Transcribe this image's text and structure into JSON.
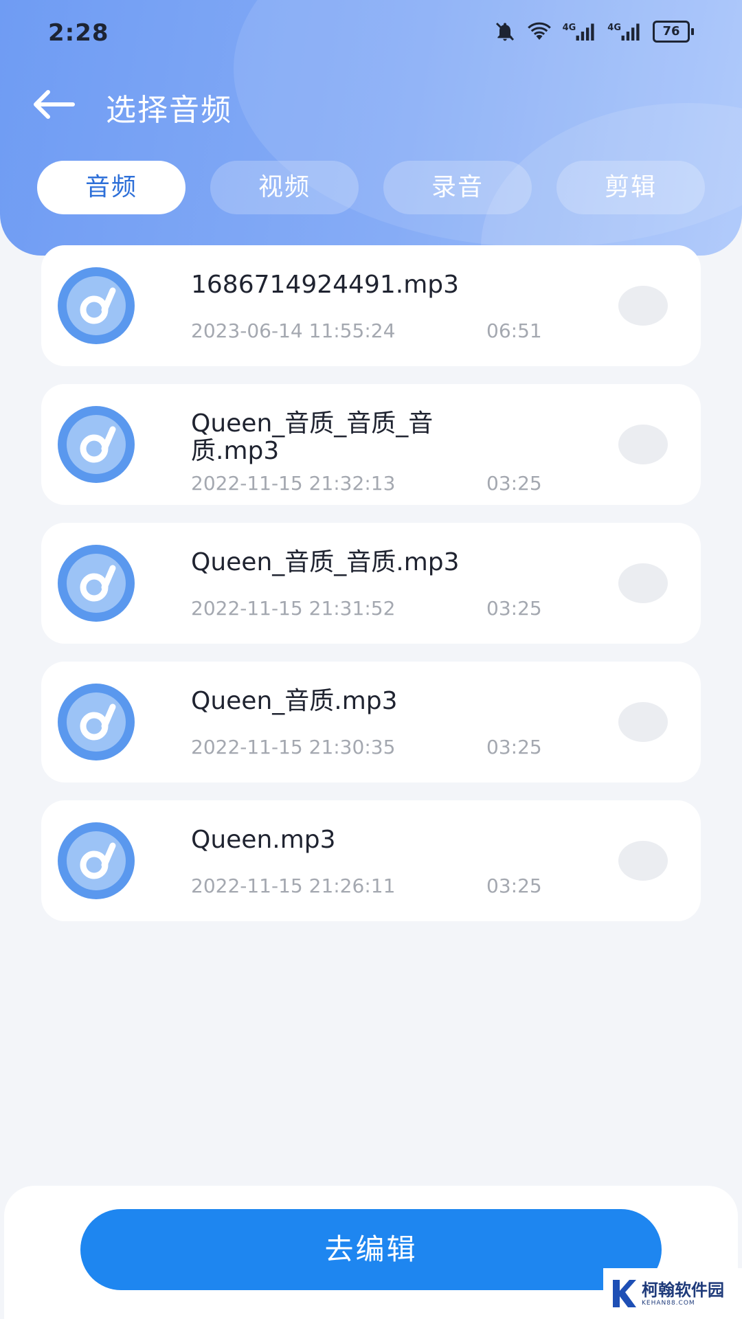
{
  "status_bar": {
    "time": "2:28",
    "network_1": "4G",
    "network_2": "4G",
    "battery": "76"
  },
  "header": {
    "title": "选择音频"
  },
  "tabs": [
    {
      "label": "音频",
      "active": true
    },
    {
      "label": "视频",
      "active": false
    },
    {
      "label": "录音",
      "active": false
    },
    {
      "label": "剪辑",
      "active": false
    }
  ],
  "files": [
    {
      "name": "1686714924491.mp3",
      "date": "2023-06-14 11:55:24",
      "duration": "06:51",
      "selected": false
    },
    {
      "name": "Queen_音质_音质_音质.mp3",
      "date": "2022-11-15 21:32:13",
      "duration": "03:25",
      "selected": false
    },
    {
      "name": "Queen_音质_音质.mp3",
      "date": "2022-11-15 21:31:52",
      "duration": "03:25",
      "selected": false
    },
    {
      "name": "Queen_音质.mp3",
      "date": "2022-11-15 21:30:35",
      "duration": "03:25",
      "selected": false
    },
    {
      "name": "Queen.mp3",
      "date": "2022-11-15 21:26:11",
      "duration": "03:25",
      "selected": false
    }
  ],
  "footer": {
    "edit_label": "去编辑"
  },
  "watermark": {
    "name": "柯翰软件园",
    "domain": "KEHAN88.COM"
  },
  "colors": {
    "accent": "#1e86f0",
    "header_gradient_start": "#6f9cf3",
    "header_gradient_end": "#a7c4fb",
    "tab_active_text": "#2d6fd8"
  }
}
